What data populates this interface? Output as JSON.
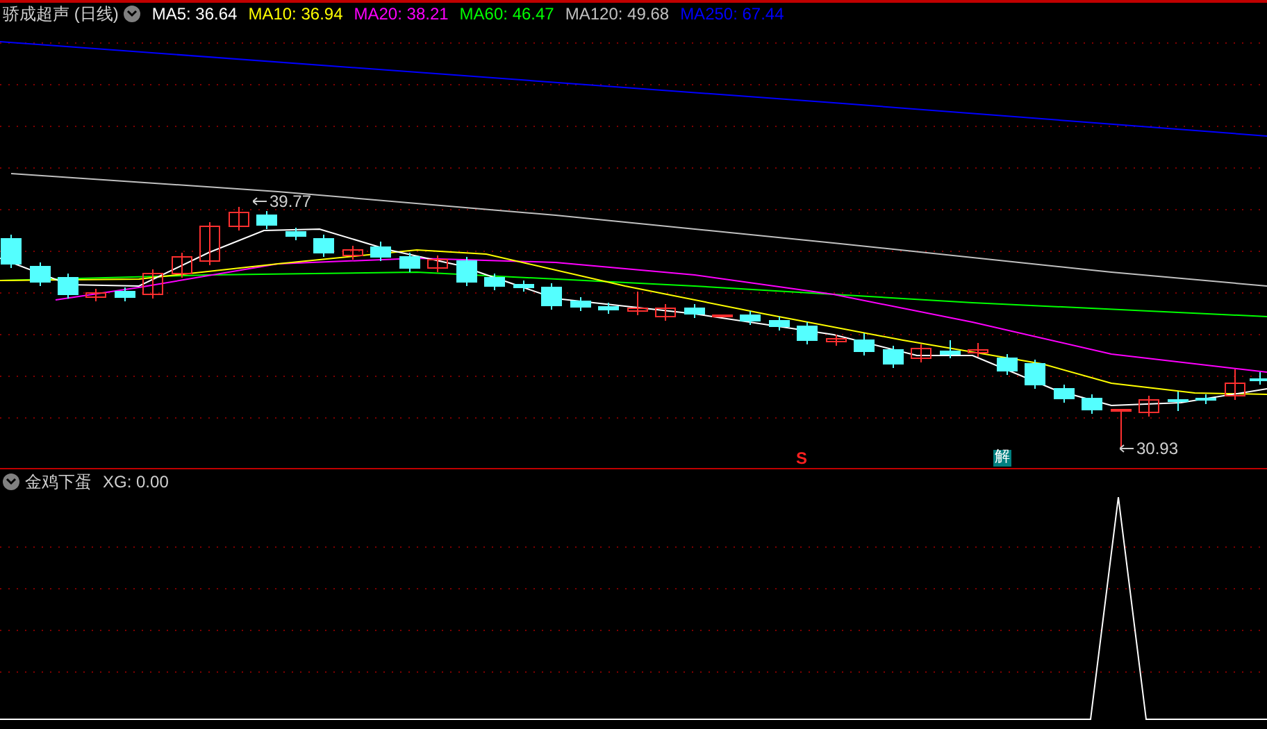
{
  "header": {
    "title": "骄成超声 (日线)",
    "indicators": [
      {
        "label": "MA5: 36.64",
        "color": "#ffffff"
      },
      {
        "label": "MA10: 36.94",
        "color": "#ffff00"
      },
      {
        "label": "MA20: 38.21",
        "color": "#ff00ff"
      },
      {
        "label": "MA60: 46.47",
        "color": "#00ff00"
      },
      {
        "label": "MA120: 49.68",
        "color": "#c0c0c0"
      },
      {
        "label": "MA250: 67.44",
        "color": "#0000ff"
      }
    ]
  },
  "price_marks": [
    {
      "kind": "high",
      "text": "39.77"
    },
    {
      "kind": "low",
      "text": "30.93"
    }
  ],
  "signals": [
    {
      "kind": "sell",
      "text": "S"
    },
    {
      "kind": "unlock",
      "text": "解"
    }
  ],
  "sub_panel": {
    "title": "金鸡下蛋",
    "reading": "XG: 0.00"
  }
}
